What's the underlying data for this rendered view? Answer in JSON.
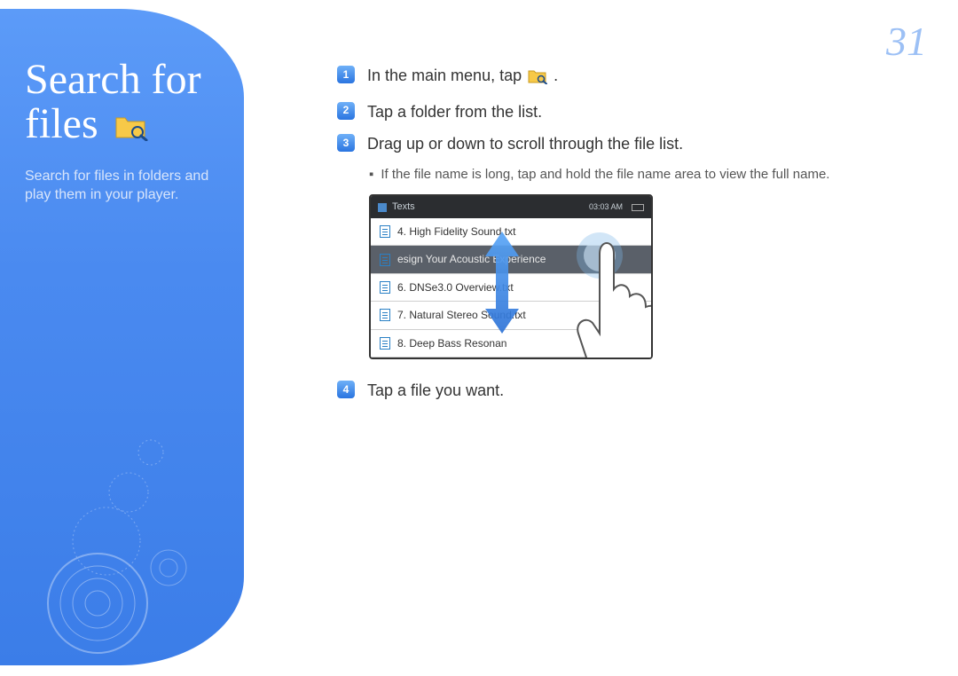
{
  "page_number": "31",
  "sidebar": {
    "title_line1": "Search for",
    "title_line2": "files",
    "subtitle": "Search for files in folders and play them in your player."
  },
  "steps": {
    "s1_pre": "In the main menu, tap",
    "s1_post": ".",
    "s2": "Tap a folder from the list.",
    "s3": "Drag up or down to scroll through the file list.",
    "s3_note": "If the file name is long, tap and hold the file name area to view the full name.",
    "s4": "Tap a file you want."
  },
  "device": {
    "header_label": "Texts",
    "header_time": "03:03 AM",
    "files": [
      "4. High Fidelity Sound.txt",
      "esign Your Acoustic Experience",
      "6. DNSe3.0 Overview.txt",
      "7. Natural Stereo Sound.txt",
      "8. Deep Bass Resonan"
    ]
  }
}
